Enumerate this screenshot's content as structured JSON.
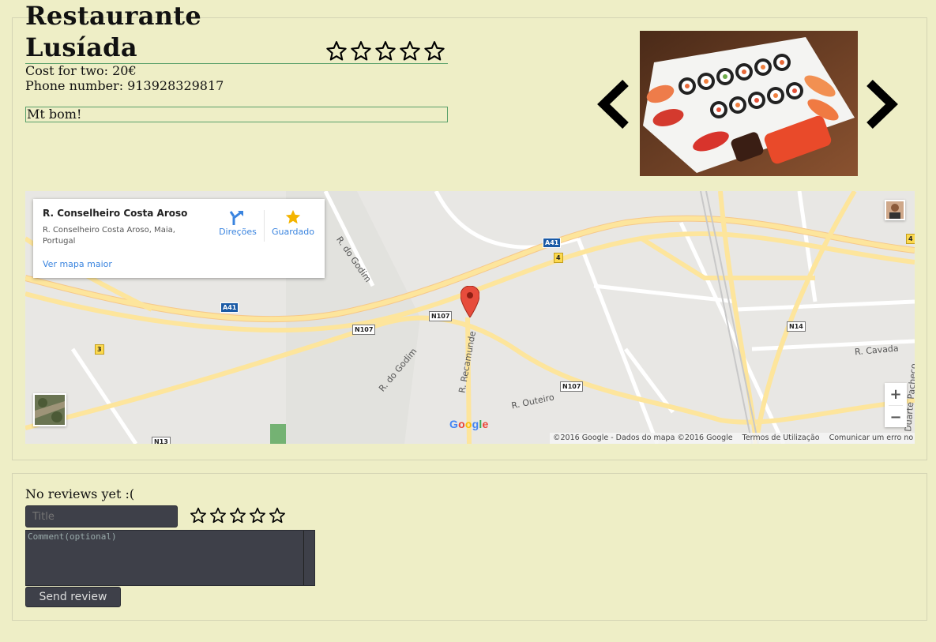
{
  "restaurant": {
    "name": "Restaurante Lusíada",
    "rating_stars": 5,
    "rating_value": 0,
    "cost_label": "Cost for two: 20€",
    "phone_label": "Phone number: 913928329817",
    "description": "Mt bom!"
  },
  "gallery": {
    "prev_icon": "chevron-left-icon",
    "next_icon": "chevron-right-icon"
  },
  "map": {
    "place_name": "R. Conselheiro Costa Aroso",
    "place_address": "R. Conselheiro Costa Aroso, Maia, Portugal",
    "directions_label": "Direções",
    "saved_label": "Guardado",
    "bigger_map_label": "Ver mapa maior",
    "zoom_in_label": "+",
    "zoom_out_label": "−",
    "google_logo": "Google",
    "footer": {
      "copyright": "©2016 Google - Dados do mapa ©2016 Google",
      "terms": "Termos de Utilização",
      "report": "Comunicar um erro no mapa"
    },
    "labels": {
      "r_do_godim_1": "R. do Godim",
      "r_do_godim_2": "R. do Godim",
      "r_recamunde": "R. Recamunde",
      "r_outeiro": "R. Outeiro",
      "r_cavada": "R. Cavada",
      "r_pacheco": "Duarte Pacheco",
      "a41_1": "A41",
      "a41_2": "A41",
      "n107_1": "N107",
      "n107_2": "N107",
      "n107_3": "N107",
      "n14": "N14",
      "n13": "N13",
      "exit_3": "3",
      "exit_4a": "4",
      "exit_4b": "4"
    }
  },
  "reviews": {
    "empty_text": "No reviews yet :(",
    "title_placeholder": "Title",
    "comment_placeholder": "Comment(optional)",
    "send_label": "Send review",
    "star_count": 5
  },
  "colors": {
    "background": "#eeeec6",
    "accent_border": "#5aa06a",
    "input_bg": "#3e4049",
    "link_blue": "#3a84df",
    "road_yellow": "#fde59c"
  }
}
